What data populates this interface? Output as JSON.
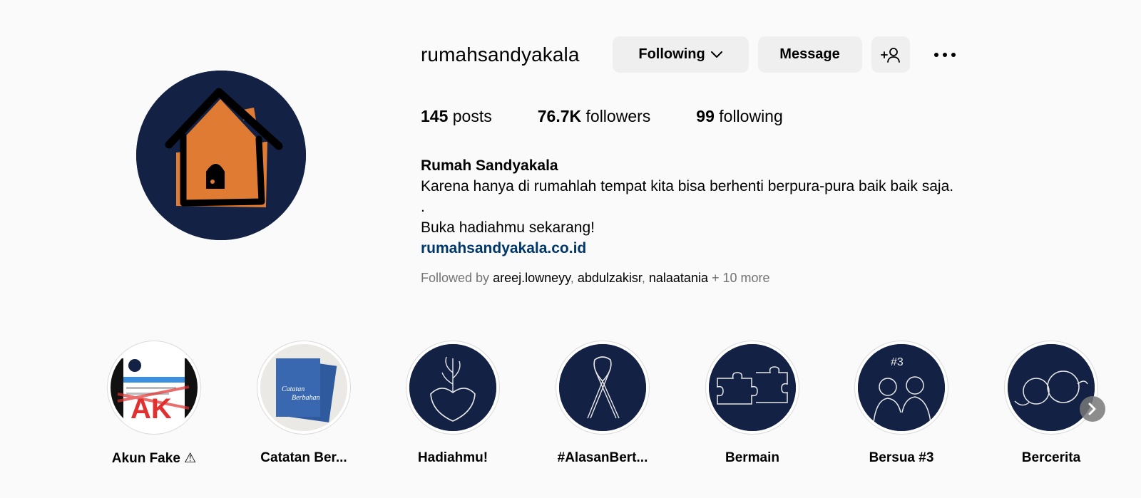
{
  "profile": {
    "username": "rumahsandyakala",
    "avatar_icon": "house-logo-icon",
    "following_label": "Following",
    "message_label": "Message",
    "add_user_icon": "add-person-icon",
    "more_icon": "more-options-icon"
  },
  "stats": {
    "posts_count": "145",
    "posts_label": "posts",
    "followers_count": "76.7K",
    "followers_label": "followers",
    "following_count": "99",
    "following_label": "following"
  },
  "bio": {
    "name": "Rumah Sandyakala",
    "line1": "Karena hanya di rumahlah tempat kita bisa berhenti berpura-pura baik baik saja.",
    "line2": ".",
    "line3": "Buka hadiahmu sekarang!",
    "link": "rumahsandyakala.co.id"
  },
  "followed_by": {
    "prefix": "Followed by",
    "accounts": [
      "areej.lowneyy",
      "abdulzakisr",
      "nalaatania"
    ],
    "more": "+ 10 more"
  },
  "highlights": [
    {
      "label": "Akun Fake ⚠"
    },
    {
      "label": "Catatan Ber..."
    },
    {
      "label": "Hadiahmu!"
    },
    {
      "label": "#AlasanBert..."
    },
    {
      "label": "Bermain"
    },
    {
      "label": "Bersua #3"
    },
    {
      "label": "Bercerita"
    }
  ],
  "colors": {
    "background": "#fafafa",
    "button": "#efefef",
    "link": "#00376b",
    "avatar_bg": "#132244",
    "house": "#e07b33"
  }
}
